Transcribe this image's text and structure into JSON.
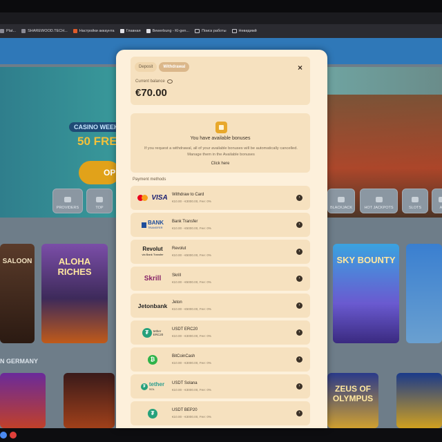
{
  "bookmarks": [
    {
      "label": "Plat..."
    },
    {
      "label": "SHAREWOOD.TECH..."
    },
    {
      "label": "Настройки аккаунта"
    },
    {
      "label": "Главная"
    },
    {
      "label": "Bewerbung - KI-gen..."
    },
    {
      "label": "Поиск работы"
    },
    {
      "label": "Невидимй"
    }
  ],
  "site": {
    "hero_pill": "CASINO WEEKL",
    "hero_text": "50 FRE",
    "hero_button": "OP",
    "categories": [
      "PROVIDERS",
      "TOP",
      "BLACKJACK",
      "HOT JACKPOTS",
      "SLOTS",
      "AL"
    ],
    "tiles": [
      "SALOON",
      "ALOHA RICHES",
      "SKY BOUNTY",
      "ZEUS OF OLYMPUS"
    ],
    "section_title": "N GERMANY"
  },
  "modal": {
    "tabs": [
      "Deposit",
      "Withdrawal"
    ],
    "active_tab": "Withdrawal",
    "close_symbol": "×",
    "balance_label": "Current balance",
    "balance": "€70.00",
    "bonus_title": "You have available bonuses",
    "bonus_desc": "If you request a withdrawal, all of your available bonuses will be automatically cancelled. Manage them in the Available bonuses",
    "bonus_link": "Click here",
    "payment_methods_label": "Payment methods",
    "methods": [
      {
        "name": "Withdraw to Card",
        "fee": "€10.00 - €3000.00, Fee: 0%"
      },
      {
        "name": "Bank Transfer",
        "fee": "€10.00 - €5000.00, Fee: 0%"
      },
      {
        "name": "Revolut",
        "fee": "€10.00 - €5000.00, Fee: 0%"
      },
      {
        "name": "Skrill",
        "fee": "€10.00 - €5000.00, Fee: 0%"
      },
      {
        "name": "Jeton",
        "fee": "€10.00 - €5000.00, Fee: 0%"
      },
      {
        "name": "USDT ERC20",
        "fee": "€10.00 - €3000.00, Fee: 0%"
      },
      {
        "name": "BitCoinCash",
        "fee": "€10.00 - €3000.00, Fee: 0%"
      },
      {
        "name": "USDT Solana",
        "fee": "€10.00 - €3000.00, Fee: 0%"
      },
      {
        "name": "USDT BEP20",
        "fee": "€10.00 - €3000.00, Fee: 0%"
      }
    ],
    "logos": {
      "visa": "VISA",
      "bank": "BANK",
      "bank_sub": "TRANSFER",
      "revolut": "Revolut",
      "revolut_sub": "via Bank Transfer",
      "skrill": "Skrill",
      "jeton": "Jetonbank",
      "tether_erc_top": "tether",
      "tether_erc_sub": "ERC20",
      "tether_sol": "tether",
      "tether_sol_sub": "SOL"
    }
  }
}
